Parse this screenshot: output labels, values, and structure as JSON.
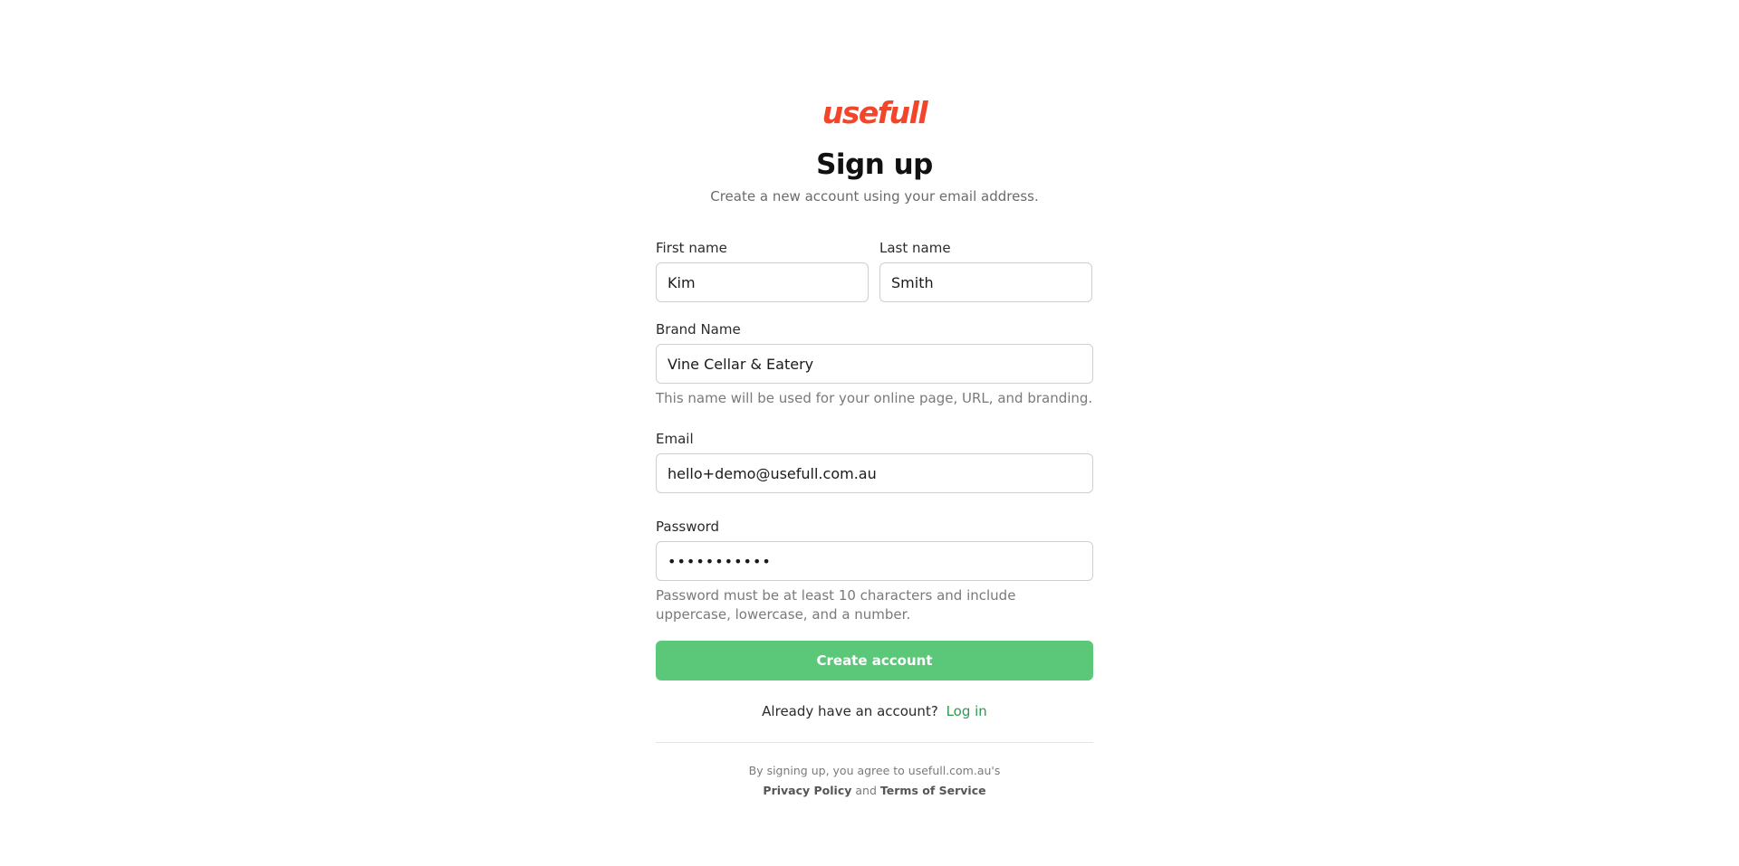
{
  "brand": {
    "logo_text": "usefull",
    "logo_color": "#f2452a"
  },
  "header": {
    "title": "Sign up",
    "subtitle": "Create a new account using your email address."
  },
  "form": {
    "first_name": {
      "label": "First name",
      "value": "Kim"
    },
    "last_name": {
      "label": "Last name",
      "value": "Smith"
    },
    "brand_name": {
      "label": "Brand Name",
      "value": "Vine Cellar & Eatery",
      "hint": "This name will be used for your online page, URL, and branding."
    },
    "email": {
      "label": "Email",
      "value": "hello+demo@usefull.com.au"
    },
    "password": {
      "label": "Password",
      "value": "•••••••••••",
      "hint": "Password must be at least 10 characters and include uppercase, lowercase, and a number."
    },
    "submit_label": "Create account",
    "submit_color": "#5ac878"
  },
  "login": {
    "prompt": "Already have an account?",
    "link_label": "Log in",
    "link_color": "#2e9a4f"
  },
  "terms": {
    "line1": "By signing up, you agree to usefull.com.au's",
    "privacy_label": "Privacy Policy",
    "and_text": "and",
    "tos_label": "Terms of Service"
  }
}
